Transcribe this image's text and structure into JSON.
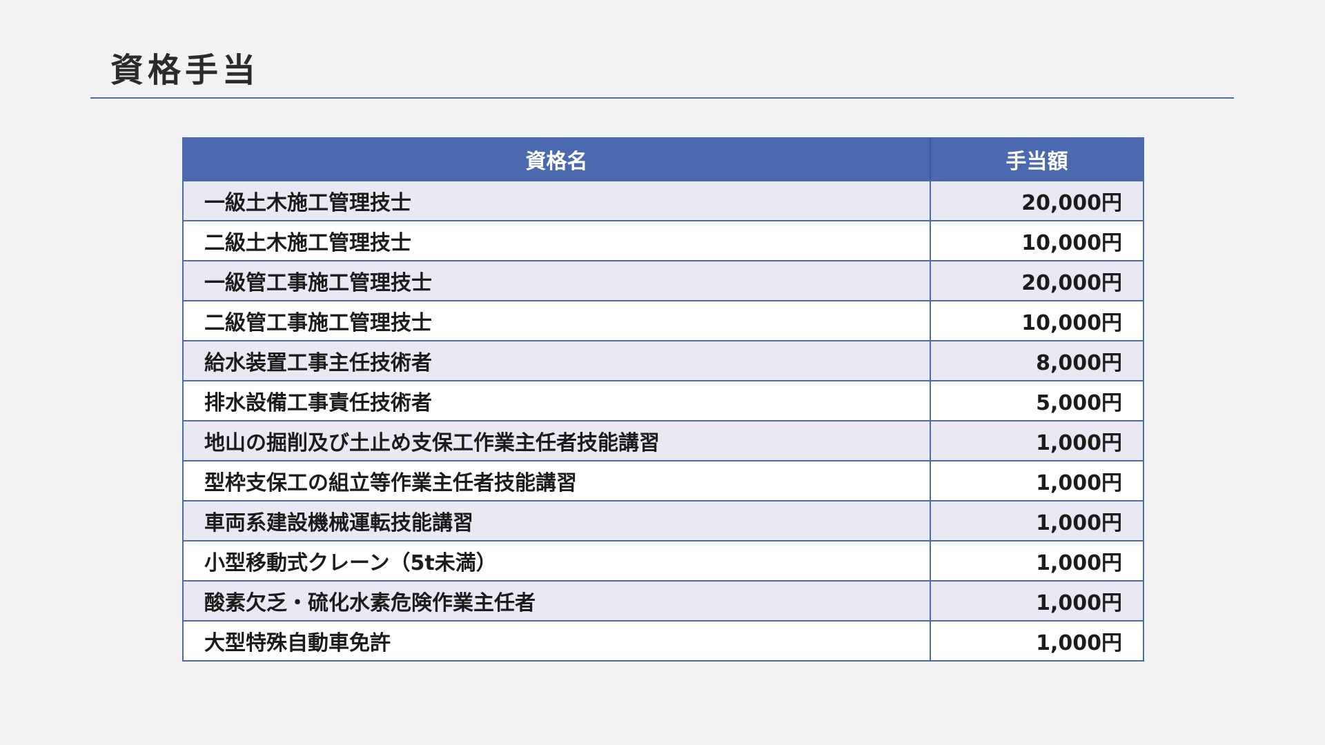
{
  "page": {
    "title": "資格手当"
  },
  "table": {
    "headers": {
      "name": "資格名",
      "amount": "手当額"
    },
    "rows": [
      {
        "name": "一級土木施工管理技士",
        "amount": "20,000円"
      },
      {
        "name": "二級土木施工管理技士",
        "amount": "10,000円"
      },
      {
        "name": "一級管工事施工管理技士",
        "amount": "20,000円"
      },
      {
        "name": "二級管工事施工管理技士",
        "amount": "10,000円"
      },
      {
        "name": "給水装置工事主任技術者",
        "amount": "8,000円"
      },
      {
        "name": "排水設備工事責任技術者",
        "amount": "5,000円"
      },
      {
        "name": "地山の掘削及び土止め支保工作業主任者技能講習",
        "amount": "1,000円"
      },
      {
        "name": "型枠支保工の組立等作業主任者技能講習",
        "amount": "1,000円"
      },
      {
        "name": "車両系建設機械運転技能講習",
        "amount": "1,000円"
      },
      {
        "name": "小型移動式クレーン（5t未満）",
        "amount": "1,000円"
      },
      {
        "name": "酸素欠乏・硫化水素危険作業主任者",
        "amount": "1,000円"
      },
      {
        "name": "大型特殊自動車免許",
        "amount": "1,000円"
      }
    ]
  },
  "colors": {
    "accent": "#4a69ae",
    "row_alt": "#e8e9f2",
    "row_plain": "#ffffff",
    "background": "#f2f2f2"
  }
}
